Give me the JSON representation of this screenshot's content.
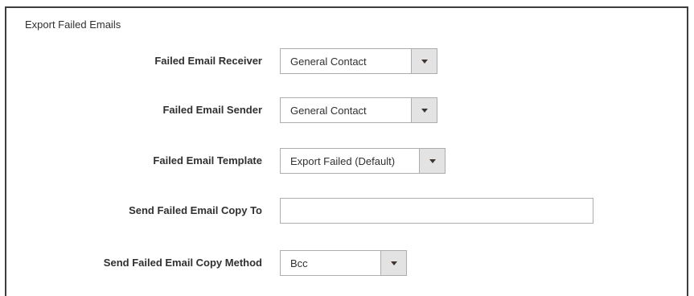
{
  "section": {
    "title": "Export Failed Emails"
  },
  "fields": [
    {
      "label": "Failed Email Receiver",
      "type": "select",
      "value": "General Contact"
    },
    {
      "label": "Failed Email Sender",
      "type": "select",
      "value": "General Contact"
    },
    {
      "label": "Failed Email Template",
      "type": "select",
      "value": "Export Failed (Default)"
    },
    {
      "label": "Send Failed Email Copy To",
      "type": "text",
      "value": "",
      "placeholder": ""
    },
    {
      "label": "Send Failed Email Copy Method",
      "type": "select",
      "value": "Bcc"
    }
  ]
}
